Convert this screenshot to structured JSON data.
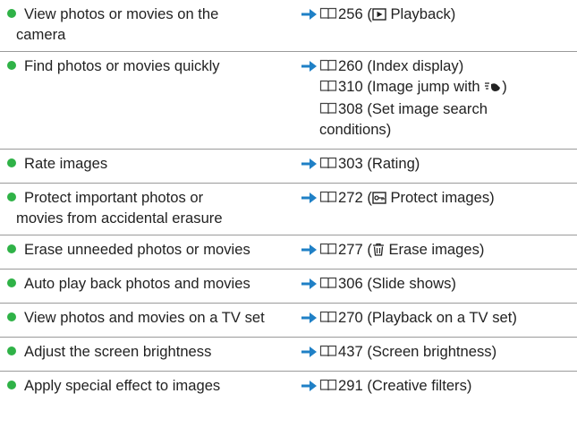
{
  "rows": [
    {
      "task_lines": [
        "View photos or movies on the",
        "camera"
      ],
      "refs": [
        {
          "page": "256",
          "pre": "(",
          "icon": "playback-icon",
          "text": " Playback)"
        }
      ]
    },
    {
      "task_lines": [
        "Find photos or movies quickly"
      ],
      "refs": [
        {
          "page": "260",
          "pre": "",
          "icon": "",
          "text": "(Index display)"
        },
        {
          "page": "310",
          "pre": "",
          "icon": "",
          "text": "(Image jump with ",
          "post_icon": "dial-jump-icon",
          "post": ")"
        },
        {
          "page": "308",
          "pre": "",
          "icon": "",
          "text": "(Set image search",
          "cont": "conditions)"
        }
      ]
    },
    {
      "task_lines": [
        "Rate images"
      ],
      "refs": [
        {
          "page": "303",
          "pre": "",
          "icon": "",
          "text": "(Rating)"
        }
      ]
    },
    {
      "task_lines": [
        "Protect important photos or",
        "movies from accidental erasure"
      ],
      "refs": [
        {
          "page": "272",
          "pre": "(",
          "icon": "protect-key-icon",
          "text": " Protect images)"
        }
      ]
    },
    {
      "task_lines": [
        "Erase unneeded photos or movies"
      ],
      "refs": [
        {
          "page": "277",
          "pre": "(",
          "icon": "trash-icon",
          "text": " Erase images)"
        }
      ]
    },
    {
      "task_lines": [
        "Auto play back photos and movies"
      ],
      "refs": [
        {
          "page": "306",
          "pre": "",
          "icon": "",
          "text": "(Slide shows)"
        }
      ]
    },
    {
      "task_lines": [
        "View photos and movies on a TV set"
      ],
      "refs": [
        {
          "page": "270",
          "pre": "",
          "icon": "",
          "text": "(Playback on a TV set)"
        }
      ]
    },
    {
      "task_lines": [
        "Adjust the screen brightness"
      ],
      "refs": [
        {
          "page": "437",
          "pre": "",
          "icon": "",
          "text": "(Screen brightness)"
        }
      ]
    },
    {
      "task_lines": [
        "Apply special effect to images"
      ],
      "refs": [
        {
          "page": "291",
          "pre": "",
          "icon": "",
          "text": "(Creative filters)"
        }
      ]
    }
  ],
  "colors": {
    "bullet": "#2fb247",
    "arrow": "#1f80c6",
    "divider": "#9a9a9a",
    "text": "#222222"
  }
}
